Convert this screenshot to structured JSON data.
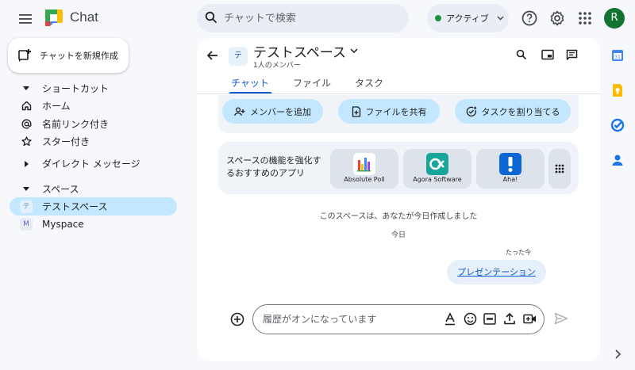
{
  "app": {
    "title": "Chat"
  },
  "search": {
    "placeholder": "チャットで検索"
  },
  "status": {
    "label": "アクティブ",
    "color": "#1e8e3e"
  },
  "account": {
    "initial": "R",
    "color": "#137333"
  },
  "sidebar": {
    "new_chat_label": "チャットを新規作成",
    "shortcuts_header": "ショートカット",
    "shortcuts": [
      {
        "label": "ホーム",
        "icon": "home-icon"
      },
      {
        "label": "名前リンク付き",
        "icon": "at-icon"
      },
      {
        "label": "スター付き",
        "icon": "star-icon"
      }
    ],
    "dm_header": "ダイレクト メッセージ",
    "spaces_header": "スペース",
    "spaces": [
      {
        "label": "テストスペース",
        "avatar": "テ",
        "active": true
      },
      {
        "label": "Myspace",
        "avatar": "M",
        "active": false
      }
    ]
  },
  "space": {
    "avatar": "テ",
    "title": "テストスペース",
    "members": "1人のメンバー",
    "tabs": [
      "チャット",
      "ファイル",
      "タスク"
    ],
    "active_tab": "チャット"
  },
  "actions": [
    "メンバーを追加",
    "ファイルを共有",
    "タスクを割り当てる"
  ],
  "apps_section": {
    "text": "スペースの機能を強化するおすすめのアプリ",
    "apps": [
      {
        "name": "Absolute Poll"
      },
      {
        "name": "Agora Software",
        "color": "#1aa59a"
      },
      {
        "name": "Aha!",
        "color": "#0a67d3"
      }
    ]
  },
  "messages": {
    "created": "このスペースは、あなたが今日作成しました",
    "date": "今日",
    "time": "たった今",
    "text": "プレゼンテーション"
  },
  "composer": {
    "placeholder": "履歴がオンになっています"
  },
  "colors": {
    "accent": "#0b57d0",
    "active_bg": "#c2e7ff",
    "page_bg": "#f6f8fc"
  }
}
